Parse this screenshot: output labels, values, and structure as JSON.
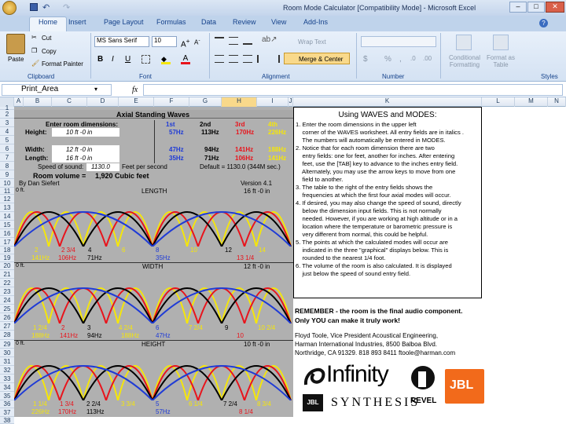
{
  "window_title": "Room Mode Calculator  [Compatibility Mode] - Microsoft Excel",
  "tabs": [
    "Home",
    "Insert",
    "Page Layout",
    "Formulas",
    "Data",
    "Review",
    "View",
    "Add-Ins"
  ],
  "ribbon": {
    "clipboard": {
      "paste": "Paste",
      "cut": "Cut",
      "copy": "Copy",
      "format_painter": "Format Painter",
      "label": "Clipboard"
    },
    "font": {
      "name": "MS Sans Serif",
      "size": "10",
      "label": "Font",
      "bold": "B",
      "italic": "I",
      "underline": "U"
    },
    "alignment": {
      "wrap": "Wrap Text",
      "merge": "Merge & Center",
      "label": "Alignment"
    },
    "number": {
      "label": "Number",
      "currency": "$",
      "percent": "%",
      "comma": ","
    },
    "styles": {
      "conditional": "Conditional Formatting",
      "format_table": "Format as Table",
      "label": "Styles"
    }
  },
  "name_box": "Print_Area",
  "fx": "fx",
  "columns": [
    "A",
    "B",
    "C",
    "D",
    "E",
    "F",
    "G",
    "H",
    "I",
    "J",
    "K",
    "L",
    "M",
    "N"
  ],
  "rows": [
    "1",
    "2",
    "3",
    "4",
    "5",
    "6",
    "7",
    "8",
    "9",
    "10",
    "11",
    "12",
    "13",
    "14",
    "15",
    "16",
    "17",
    "18",
    "19",
    "20",
    "21",
    "22",
    "23",
    "24",
    "25",
    "26",
    "27",
    "28",
    "29",
    "30",
    "31",
    "32",
    "33",
    "34",
    "35",
    "36",
    "37",
    "38"
  ],
  "sheet": {
    "title": "Axial Standing Waves",
    "enter_dims": "Enter room dimensions:",
    "height_label": "Height:",
    "height_val": "10 ft  -0 in",
    "width_label": "Width:",
    "width_val": "12 ft  -0 in",
    "length_label": "Length:",
    "length_val": "16 ft  -0 in",
    "order_1st": "1st",
    "order_2nd": "2nd",
    "order_3rd": "3rd",
    "order_4th": "4th",
    "h_modes": [
      "57Hz",
      "113Hz",
      "170Hz",
      "226Hz"
    ],
    "w_modes": [
      "47Hz",
      "94Hz",
      "141Hz",
      "188Hz"
    ],
    "l_modes": [
      "35Hz",
      "71Hz",
      "106Hz",
      "141Hz"
    ],
    "sos_label": "Speed of sound:",
    "sos_val": "1130.0",
    "sos_unit": "Feet per second",
    "default": "Default = 1130.0 (344M sec.)",
    "vol_label": "Room volume =",
    "vol_val": "1,920 Cubic feet",
    "author": "By Dan Siefert",
    "version": "Version 4.1",
    "len_title": "LENGTH",
    "len_start": "0 ft.",
    "len_end": "16 ft  -0 in",
    "len_pos": [
      "2",
      "2 3/4",
      "4",
      "6",
      "8",
      "10",
      "12",
      "14"
    ],
    "len_hz": [
      "141Hz",
      "106Hz",
      "71Hz",
      "35Hz",
      "13 1/4"
    ],
    "wid_title": "WIDTH",
    "wid_start": "0 ft.",
    "wid_end": "12 ft  -0 in",
    "wid_pos": [
      "1 2/4",
      "2",
      "3",
      "4 2/4",
      "6",
      "7 2/4",
      "9",
      "10 2/4"
    ],
    "wid_hz": [
      "188Hz",
      "141Hz",
      "94Hz",
      "188Hz",
      "47Hz",
      "10"
    ],
    "hei_title": "HEIGHT",
    "hei_start": "0 ft.",
    "hei_end": "10 ft  -0 in",
    "hei_pos": [
      "1 1/4",
      "1 3/4",
      "2 2/4",
      "3 3/4",
      "5",
      "6 1/4",
      "7 2/4",
      "8 3/4"
    ],
    "hei_hz": [
      "226Hz",
      "170Hz",
      "113Hz",
      "57Hz",
      "8 1/4"
    ]
  },
  "notes": {
    "title": "Using WAVES and MODES:",
    "items": [
      "1. Enter the room dimensions in the upper left",
      "    corner of the WAVES worksheet. All entry fields are in italics .",
      "    The numbers will automatically be entered in MODES.",
      "2. Notice that for each room dimension there are two",
      "    entry fields: one for feet, another for inches. After entering",
      "    feet, use the [TAB] key to advance to the inches entry field.",
      "    Alternately, you may use the arrow keys to move from one",
      "    field to another.",
      "3. The table to the right of the entry fields shows the",
      "    frequencies at which the first four axial modes will occur.",
      "4. If desired, you may also change the speed of sound, directly",
      "    below the dimension input fields. This is not normally",
      "    needed. However, if you are working at high altitude or in a",
      "    location where the temperature or barometric pressure is",
      "    very different from normal, this could be helpful.",
      "5. The points at which the calculated modes will occur are",
      "    indicated in the three \"graphical\" displays below. This is",
      "    rounded to the nearest 1/4 foot.",
      "6. The volume of the room is also calculated. It is displayed",
      "    just below the speed of sound entry field."
    ]
  },
  "remember1": "REMEMBER  - the room is the final audio component.",
  "remember2": "Only YOU can make it truly work!",
  "credit": [
    "Floyd Toole, Vice President Acoustical Engineering,",
    "Harman International Industries, 8500 Balboa Blvd.",
    "Northridge, CA 91329.  818 893 8411  ftoole@harman.com"
  ],
  "logos": {
    "infinity": "Infinity",
    "jbl": "JBL",
    "synthesis": "SYNTHESIS",
    "revel": "REVEL"
  },
  "colors": {
    "blue": "#1f3bd6",
    "red": "#e8141c",
    "yellow": "#f5e60a",
    "black": "#000000",
    "accent_blue": "#2a35c8",
    "ribbon": "#dbe6f4"
  }
}
